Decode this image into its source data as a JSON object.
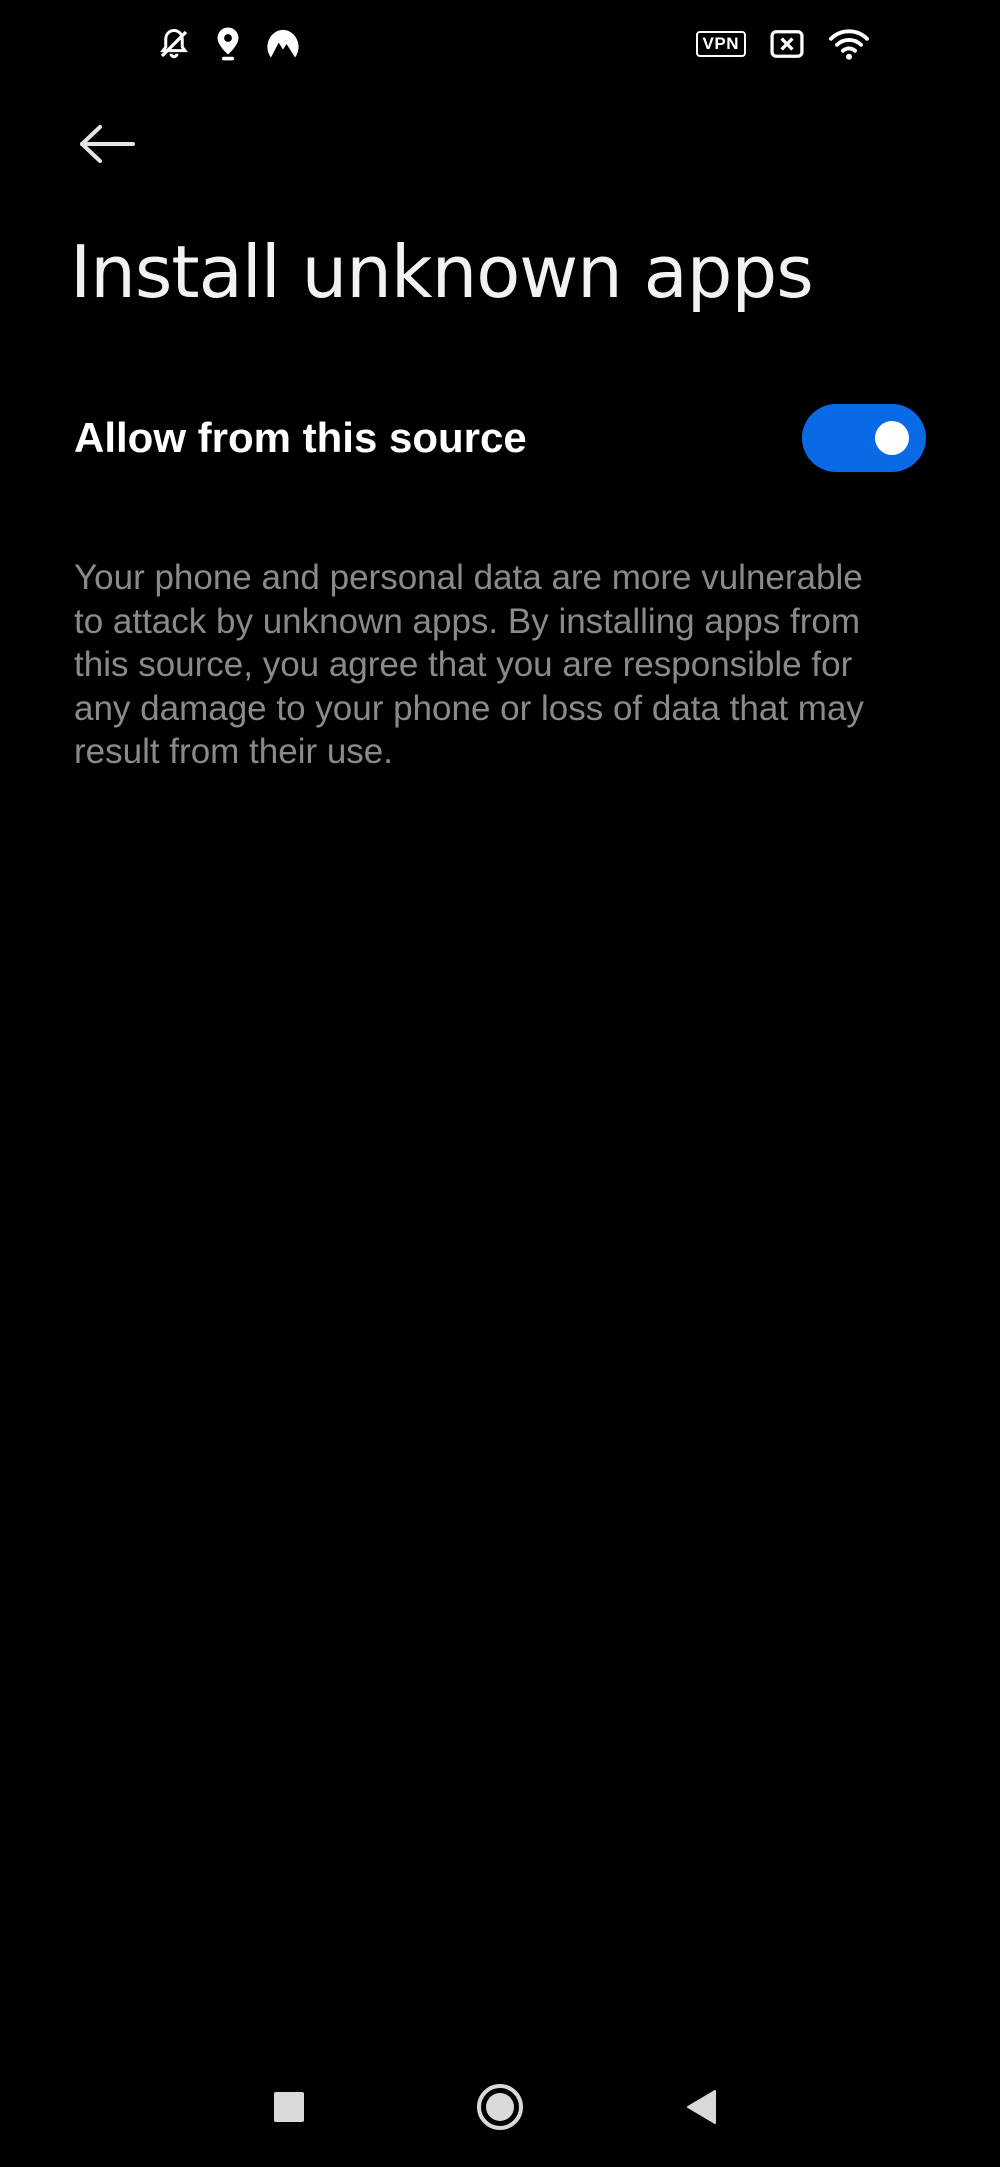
{
  "status_bar": {
    "left_icons": [
      "bell-off-icon",
      "location-icon",
      "nordvpn-icon"
    ],
    "vpn_label": "VPN",
    "right_icons": [
      "vpn-badge-icon",
      "battery-x-icon",
      "wifi-icon"
    ]
  },
  "header": {
    "back_icon": "arrow-left-icon",
    "title": "Install unknown apps"
  },
  "setting": {
    "label": "Allow from this source",
    "enabled": true,
    "toggle_color": "#0a6ae6"
  },
  "description": "Your phone and personal data are more vulnerable to attack by unknown apps. By installing apps from this source, you agree that you are responsible for any damage to your phone or loss of data that may result from their use.",
  "nav_bar": {
    "buttons": [
      "recents-square-icon",
      "home-circle-icon",
      "back-triangle-icon"
    ]
  }
}
